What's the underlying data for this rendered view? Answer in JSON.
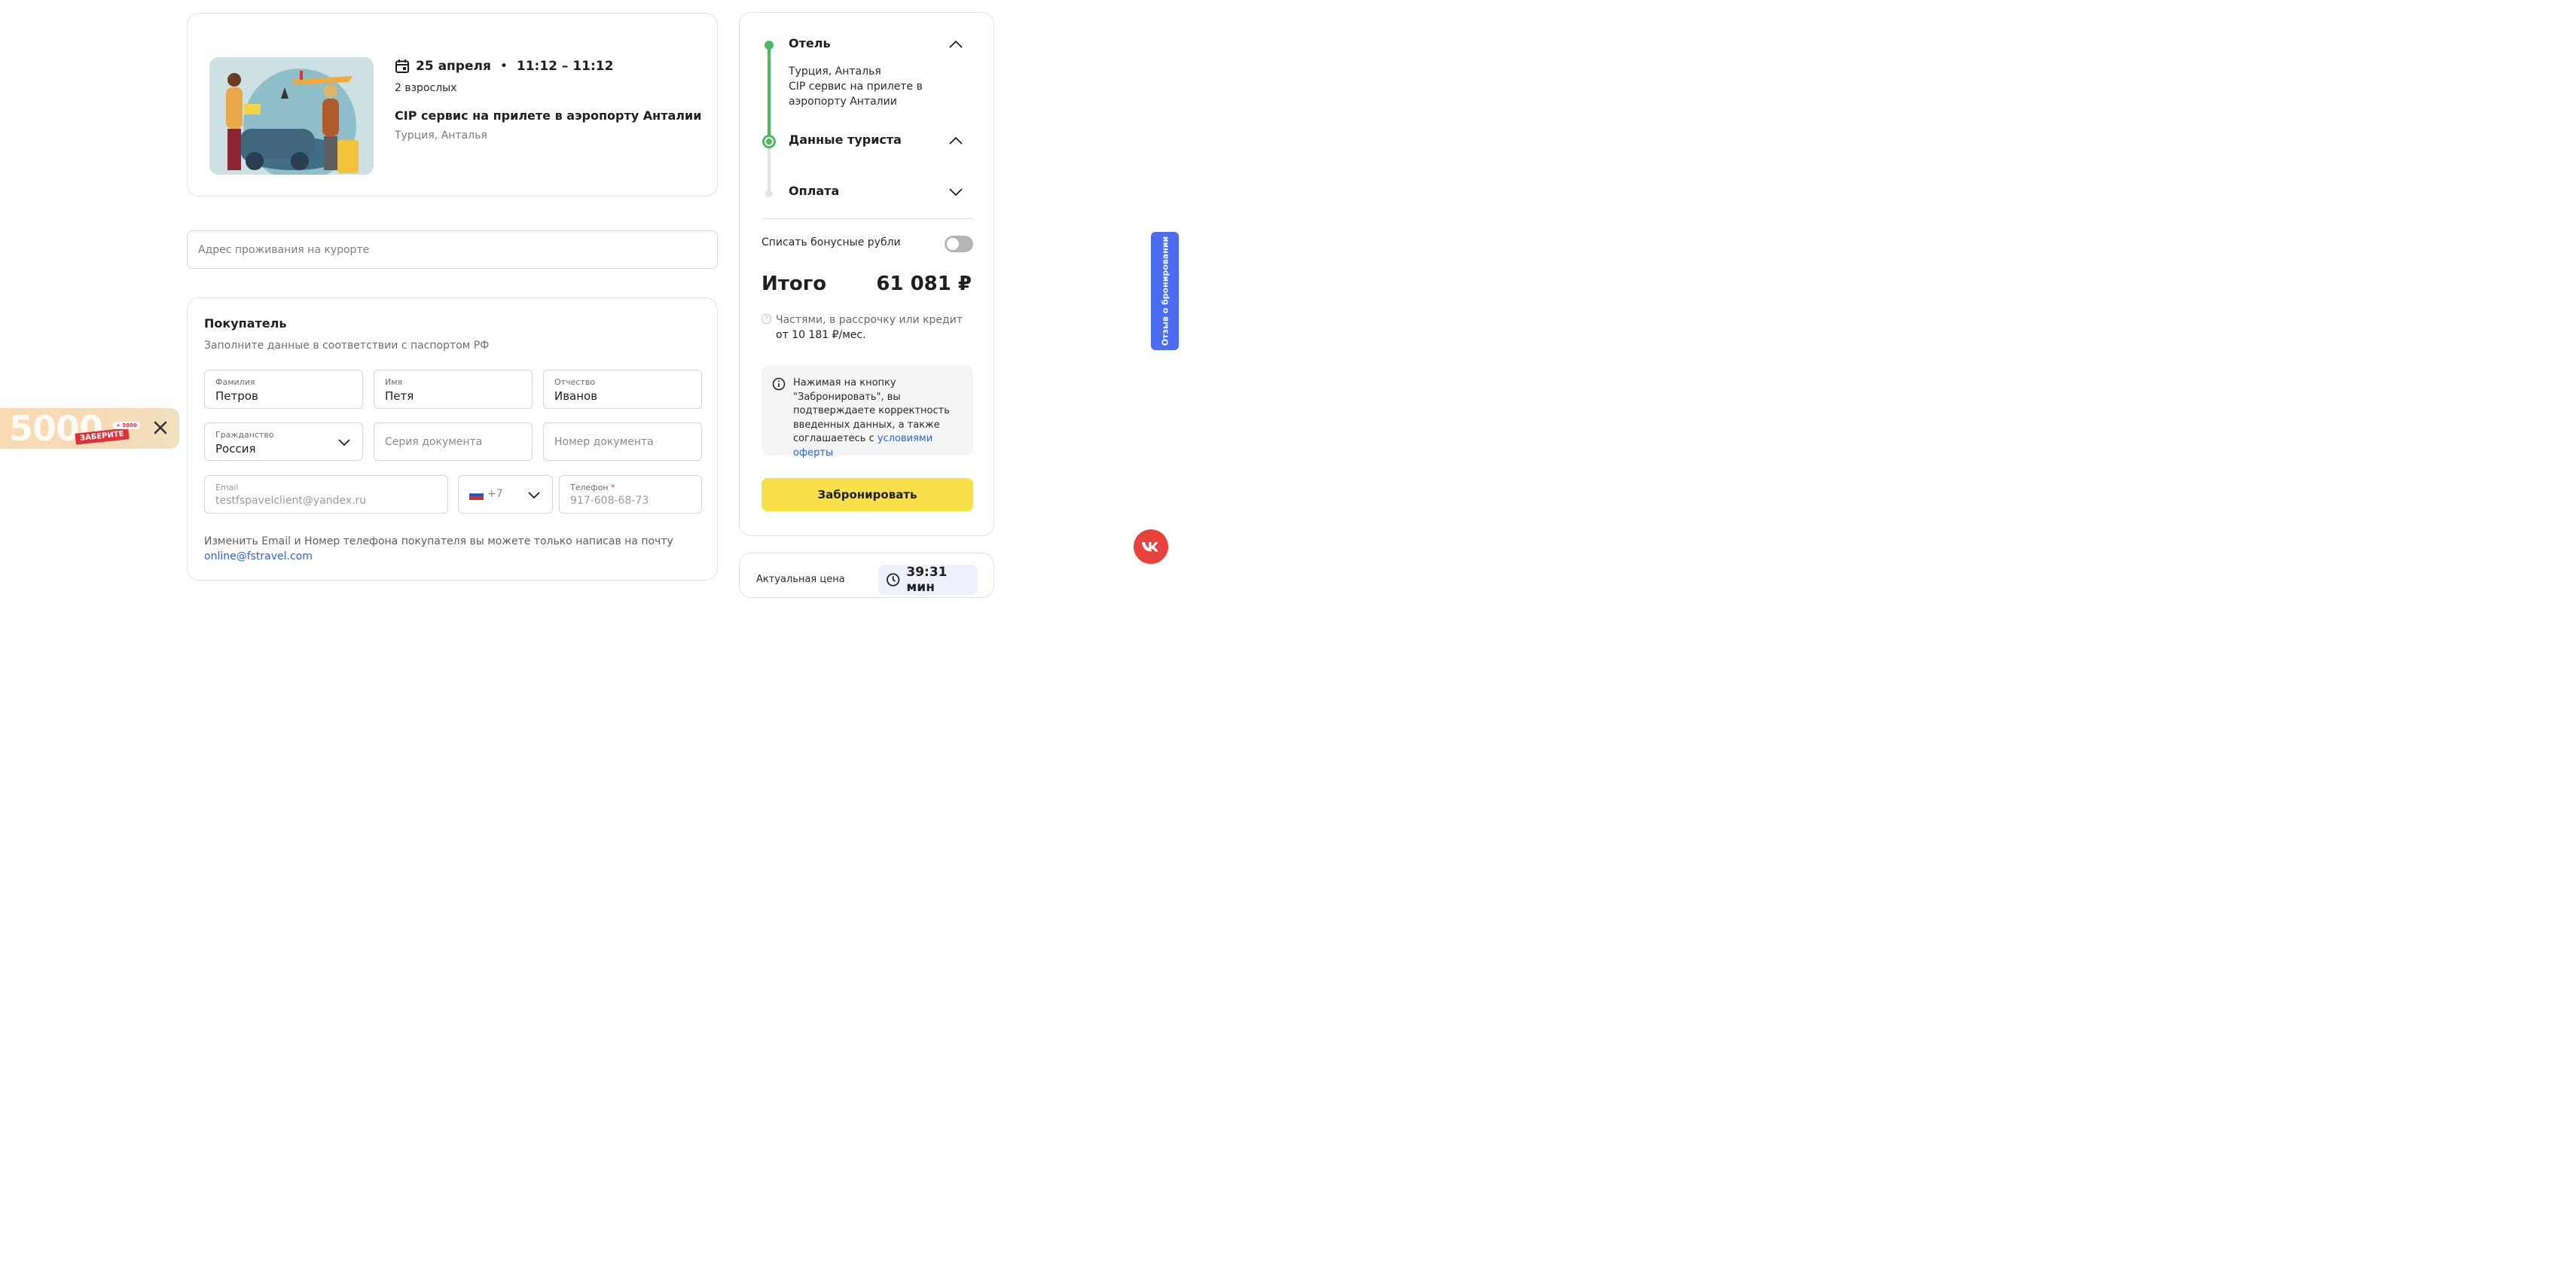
{
  "product": {
    "date": "25 апреля",
    "separator": "•",
    "time": "11:12 – 11:12",
    "guests": "2 взрослых",
    "title": "CIP сервис на прилете в аэропорту Анталии",
    "location": "Турция, Анталья",
    "icon": "calendar-icon"
  },
  "address": {
    "placeholder": "Адрес проживания на курорте"
  },
  "buyer": {
    "title": "Покупатель",
    "subtitle": "Заполните данные в соответствии с паспортом РФ",
    "surname": {
      "label": "Фамилия",
      "value": "Петров"
    },
    "name": {
      "label": "Имя",
      "value": "Петя"
    },
    "patronymic": {
      "label": "Отчество",
      "value": "Иванов"
    },
    "citizenship": {
      "label": "Гражданство",
      "value": "Россия"
    },
    "doc_series": {
      "placeholder": "Серия документа"
    },
    "doc_number": {
      "placeholder": "Номер документа"
    },
    "email": {
      "label": "Email",
      "value": "testfspavelclient@yandex.ru"
    },
    "phone_code": "+7",
    "phone": {
      "label": "Телефон",
      "required_mark": "*",
      "value": "917-608-68-73"
    },
    "note": "Изменить Email и Номер телефона покупателя вы можете только написав на почту",
    "note_email": "online@fstravel.com"
  },
  "sidebar": {
    "steps": [
      {
        "title": "Отель",
        "details": "Турция, Анталья",
        "details2": "CIP сервис на прилете в аэропорту Анталии"
      },
      {
        "title": "Данные туриста"
      },
      {
        "title": "Оплата"
      }
    ],
    "bonus_label": "Списать бонусные рубли",
    "total_label": "Итого",
    "total_amount": "61 081 ₽",
    "installment_line1": "Частями, в рассрочку или кредит",
    "installment_line2": "от 10 181 ₽/мес.",
    "info_text": "Нажимая на кнопку \"Забронировать\", вы подтверждаете корректность введенных данных, а также соглашаетесь с",
    "info_link": "условиями оферты",
    "book_button": "Забронировать"
  },
  "timer": {
    "label": "Актуальная цена",
    "value": "39:31 мин"
  },
  "promo": {
    "big": "5000",
    "tag": "ЗАБЕРИТЕ",
    "badge": "+ 5000"
  },
  "feedback_tab": "Отзыв о бронировании",
  "colors": {
    "accent_green": "#4db85d",
    "book_yellow": "#f8e04b",
    "link_blue": "#2d62dd",
    "feedback_blue": "#4c6cf0",
    "vk_red": "#e8423c"
  }
}
